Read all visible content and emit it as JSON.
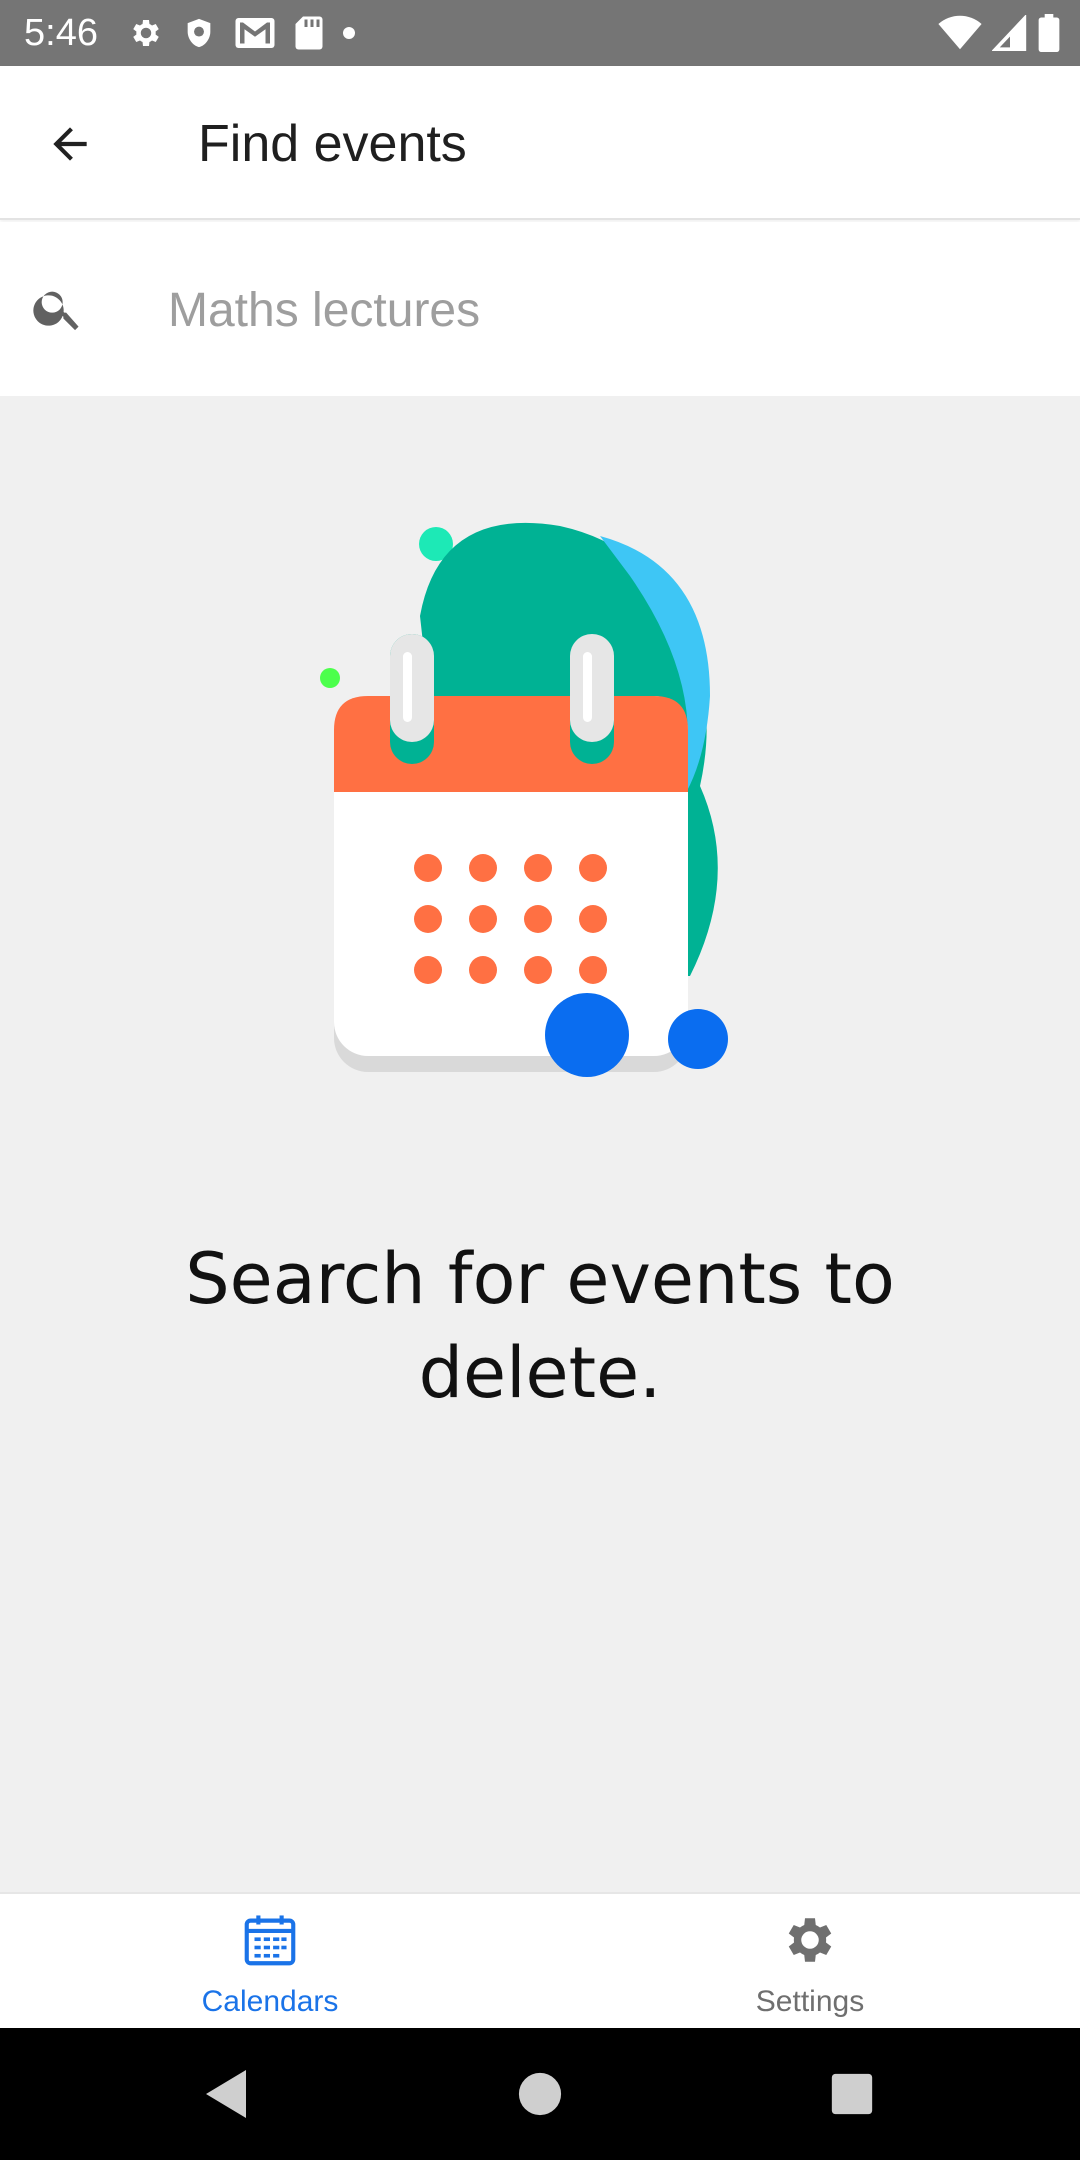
{
  "status_bar": {
    "time": "5:46",
    "left_icons": [
      "settings-gear-icon",
      "shield-icon",
      "gmail-icon",
      "sd-card-icon",
      "dot-icon"
    ],
    "right_icons": [
      "wifi-icon",
      "signal-icon",
      "battery-icon"
    ]
  },
  "app_bar": {
    "back_icon": "arrow-back-icon",
    "title": "Find events"
  },
  "search": {
    "icon": "search-icon",
    "placeholder": "Maths lectures",
    "value": ""
  },
  "empty_state": {
    "illustration": "calendar-illustration",
    "message": "Search for events to delete."
  },
  "bottom_nav": {
    "items": [
      {
        "label": "Calendars",
        "icon": "calendar-icon",
        "active": true
      },
      {
        "label": "Settings",
        "icon": "gear-icon",
        "active": false
      }
    ]
  },
  "system_nav": {
    "buttons": [
      "back-triangle-icon",
      "home-circle-icon",
      "recents-square-icon"
    ]
  },
  "colors": {
    "status_bar": "#757575",
    "accent": "#1a73e8",
    "calendar_header": "#ff7043",
    "background": "#f0f0f0"
  }
}
